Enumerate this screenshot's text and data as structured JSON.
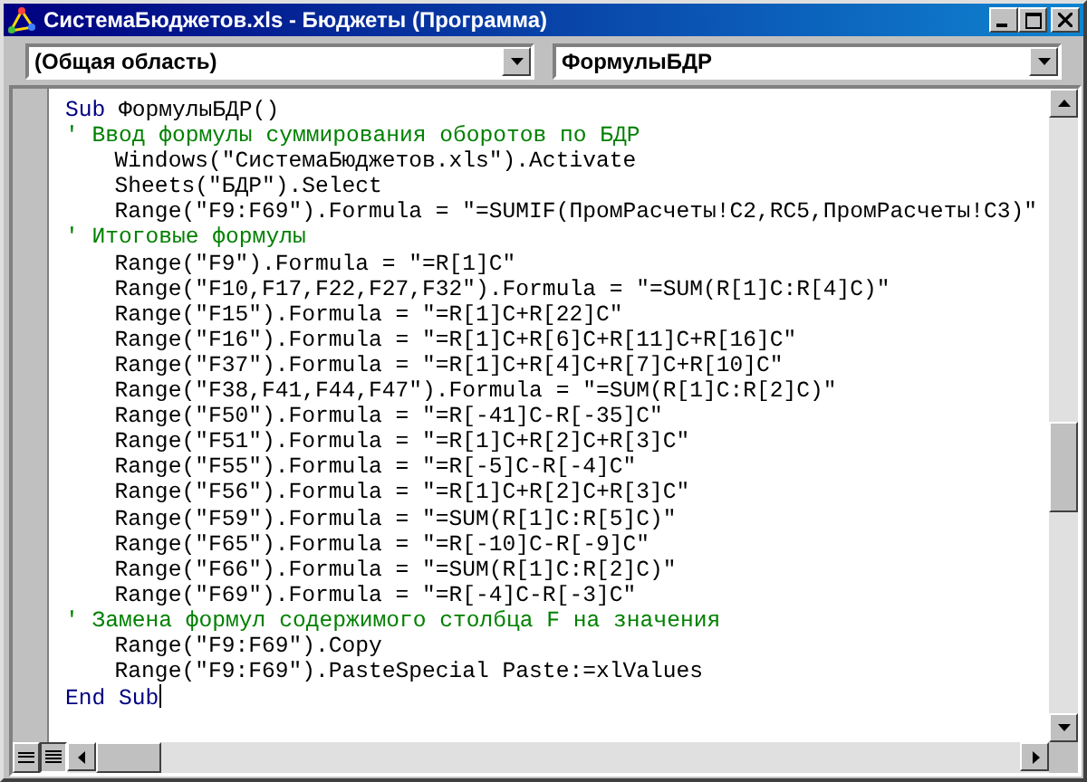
{
  "window": {
    "title": "СистемаБюджетов.xls - Бюджеты (Программа)"
  },
  "object_box": {
    "value": "(Общая область)"
  },
  "procedure_box": {
    "value": "ФормулыБДР"
  },
  "code_lines": [
    {
      "kind": "declaration",
      "keyword": "Sub",
      "text": " ФормулыБДР()"
    },
    {
      "kind": "comment",
      "text": "' Ввод формулы суммирования оборотов по БДР"
    },
    {
      "kind": "statement",
      "text": "Windows(\"СистемаБюджетов.xls\").Activate"
    },
    {
      "kind": "statement",
      "text": "Sheets(\"БДР\").Select"
    },
    {
      "kind": "statement",
      "text": "Range(\"F9:F69\").Formula = \"=SUMIF(ПромРасчеты!C2,RC5,ПромРасчеты!C3)\""
    },
    {
      "kind": "comment",
      "text": "' Итоговые формулы"
    },
    {
      "kind": "statement",
      "text": "Range(\"F9\").Formula = \"=R[1]C\""
    },
    {
      "kind": "statement",
      "text": "Range(\"F10,F17,F22,F27,F32\").Formula = \"=SUM(R[1]C:R[4]C)\""
    },
    {
      "kind": "statement",
      "text": "Range(\"F15\").Formula = \"=R[1]C+R[22]C\""
    },
    {
      "kind": "statement",
      "text": "Range(\"F16\").Formula = \"=R[1]C+R[6]C+R[11]C+R[16]C\""
    },
    {
      "kind": "statement",
      "text": "Range(\"F37\").Formula = \"=R[1]C+R[4]C+R[7]C+R[10]C\""
    },
    {
      "kind": "statement",
      "text": "Range(\"F38,F41,F44,F47\").Formula = \"=SUM(R[1]C:R[2]C)\""
    },
    {
      "kind": "statement",
      "text": "Range(\"F50\").Formula = \"=R[-41]C-R[-35]C\""
    },
    {
      "kind": "statement",
      "text": "Range(\"F51\").Formula = \"=R[1]C+R[2]C+R[3]C\""
    },
    {
      "kind": "statement",
      "text": "Range(\"F55\").Formula = \"=R[-5]C-R[-4]C\""
    },
    {
      "kind": "statement",
      "text": "Range(\"F56\").Formula = \"=R[1]C+R[2]C+R[3]C\""
    },
    {
      "kind": "statement",
      "text": "Range(\"F59\").Formula = \"=SUM(R[1]C:R[5]C)\""
    },
    {
      "kind": "statement",
      "text": "Range(\"F65\").Formula = \"=R[-10]C-R[-9]C\""
    },
    {
      "kind": "statement",
      "text": "Range(\"F66\").Formula = \"=SUM(R[1]C:R[2]C)\""
    },
    {
      "kind": "statement",
      "text": "Range(\"F69\").Formula = \"=R[-4]C-R[-3]C\""
    },
    {
      "kind": "comment",
      "text": "' Замена формул содержимого столбца F на значения"
    },
    {
      "kind": "statement",
      "text": "Range(\"F9:F69\").Copy"
    },
    {
      "kind": "statement",
      "text": "Range(\"F9:F69\").PasteSpecial Paste:=xlValues"
    },
    {
      "kind": "keyword_line",
      "text": "End Sub"
    }
  ]
}
